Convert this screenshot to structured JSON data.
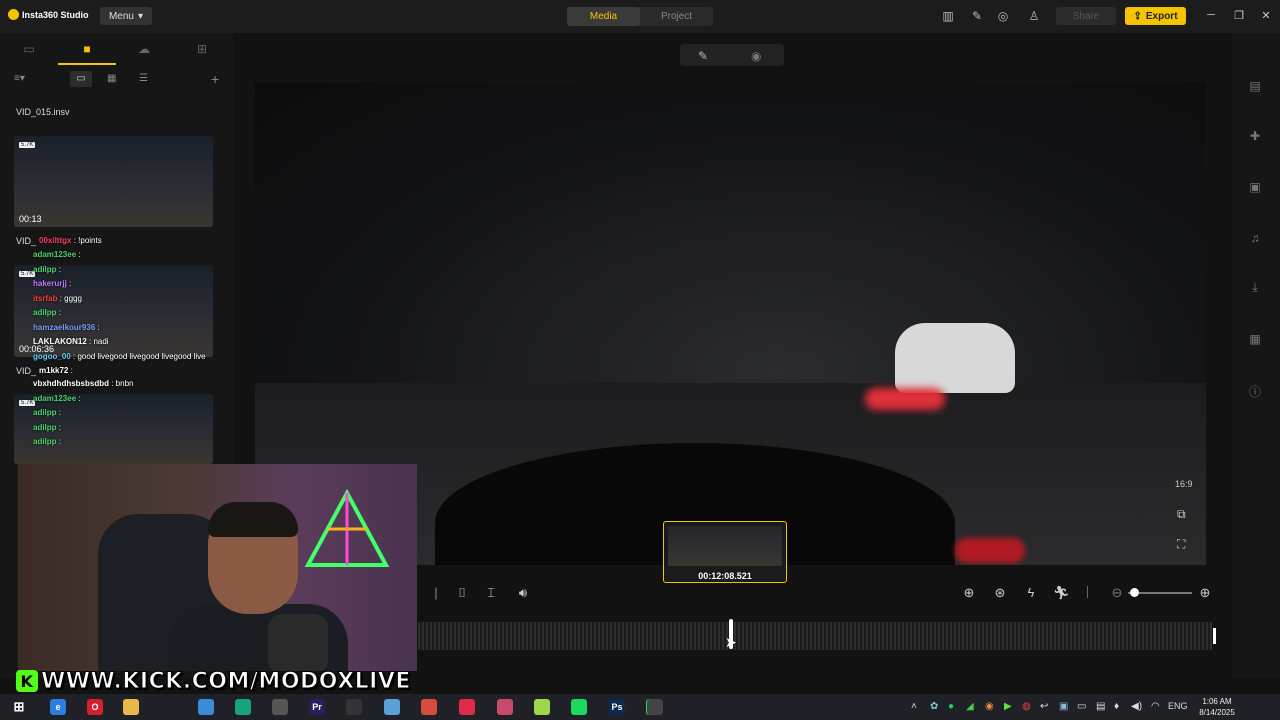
{
  "app": {
    "title": "Insta360 Studio",
    "menu_label": "Menu"
  },
  "top_tabs": [
    {
      "label": "Media",
      "active": true
    },
    {
      "label": "Project",
      "active": false
    }
  ],
  "share_label": "Share",
  "export_label": "Export",
  "accent_color": "#f4c400",
  "sidebar": {
    "files": [
      {
        "name": "VID_015.insv"
      },
      {
        "badge": "5.7K",
        "duration": "00:13"
      },
      {
        "name": "VID_",
        "badge": "5.7K",
        "duration": "00:06:36"
      },
      {
        "name": "VID_",
        "badge": "5.7K"
      }
    ]
  },
  "chat": [
    {
      "user": "00xilttgx",
      "msg": ": !points",
      "color": "#ff3b6b"
    },
    {
      "user": "adam123ee",
      "msg": ":",
      "color": "#4bd36a"
    },
    {
      "user": "adilpp",
      "msg": ":",
      "color": "#4bd36a"
    },
    {
      "user": "hakerurjj",
      "msg": ":",
      "color": "#c07bff"
    },
    {
      "user": "itsrfab",
      "msg": ": gggg",
      "color": "#ff3b3b"
    },
    {
      "user": "adilpp",
      "msg": ":",
      "color": "#4bd36a"
    },
    {
      "user": "hamzaelkour936",
      "msg": ":",
      "color": "#7c9cff"
    },
    {
      "user": "LAKLAKON12",
      "msg": ": nadi",
      "color": "#ffffff"
    },
    {
      "user": "gogoo_00",
      "msg": ": good livegood livegood livegood live",
      "color": "#5ad1ff"
    },
    {
      "user": "m1kk72",
      "msg": ":",
      "color": "#ffffff"
    },
    {
      "user": "vbxhdhdhsbsbsdbd",
      "msg": ": bnbn",
      "color": "#ffffff"
    },
    {
      "user": "adam123ee",
      "msg": ":",
      "color": "#4bd36a"
    },
    {
      "user": "adilpp",
      "msg": ":",
      "color": "#4bd36a"
    },
    {
      "user": "adilpp",
      "msg": ":",
      "color": "#4bd36a"
    },
    {
      "user": "adilpp",
      "msg": ":",
      "color": "#4bd36a"
    }
  ],
  "preview": {
    "aspect_label": "16:9"
  },
  "scrub_preview_time": "00:12:08.521",
  "zoom_level": 0.1,
  "overlay": {
    "stream_url": "WWW.KICK.COM/MODOXLIVE",
    "kick_letter": "K"
  },
  "taskbar": {
    "lang": "ENG",
    "time": "1:06 AM",
    "date": "8/14/2025",
    "apps": [
      {
        "icon": "edge-icon",
        "label": "e",
        "color": "#2a7de1"
      },
      {
        "icon": "opera-icon",
        "label": "O",
        "color": "#d4202a"
      },
      {
        "icon": "folder-icon",
        "label": "",
        "color": "#e8b84a"
      },
      {
        "icon": "store-icon",
        "label": "",
        "color": "#3a8bd8"
      },
      {
        "icon": "app-green-icon",
        "label": "",
        "color": "#18a37a"
      },
      {
        "icon": "app-gray-icon",
        "label": "",
        "color": "#555555"
      },
      {
        "icon": "premiere-icon",
        "label": "Pr",
        "color": "#2c1e5e"
      },
      {
        "icon": "obs-icon",
        "label": "",
        "color": "#333333"
      },
      {
        "icon": "app-blue-icon",
        "label": "",
        "color": "#5a9fd6"
      },
      {
        "icon": "chrome-icon",
        "label": "",
        "color": "#d84a3c"
      },
      {
        "icon": "tiktok-icon",
        "label": "",
        "color": "#e02a4a"
      },
      {
        "icon": "app-pink-icon",
        "label": "",
        "color": "#c84a6a"
      },
      {
        "icon": "bluestacks-icon",
        "label": "",
        "color": "#9bd84a"
      },
      {
        "icon": "spotify-icon",
        "label": "",
        "color": "#1ed760"
      },
      {
        "icon": "photoshop-icon",
        "label": "Ps",
        "color": "#0b2a4e"
      },
      {
        "icon": "whatsapp-icon",
        "label": "",
        "color": "#25d366"
      },
      {
        "icon": "insta360-icon",
        "label": "",
        "color": "#444444"
      }
    ]
  }
}
